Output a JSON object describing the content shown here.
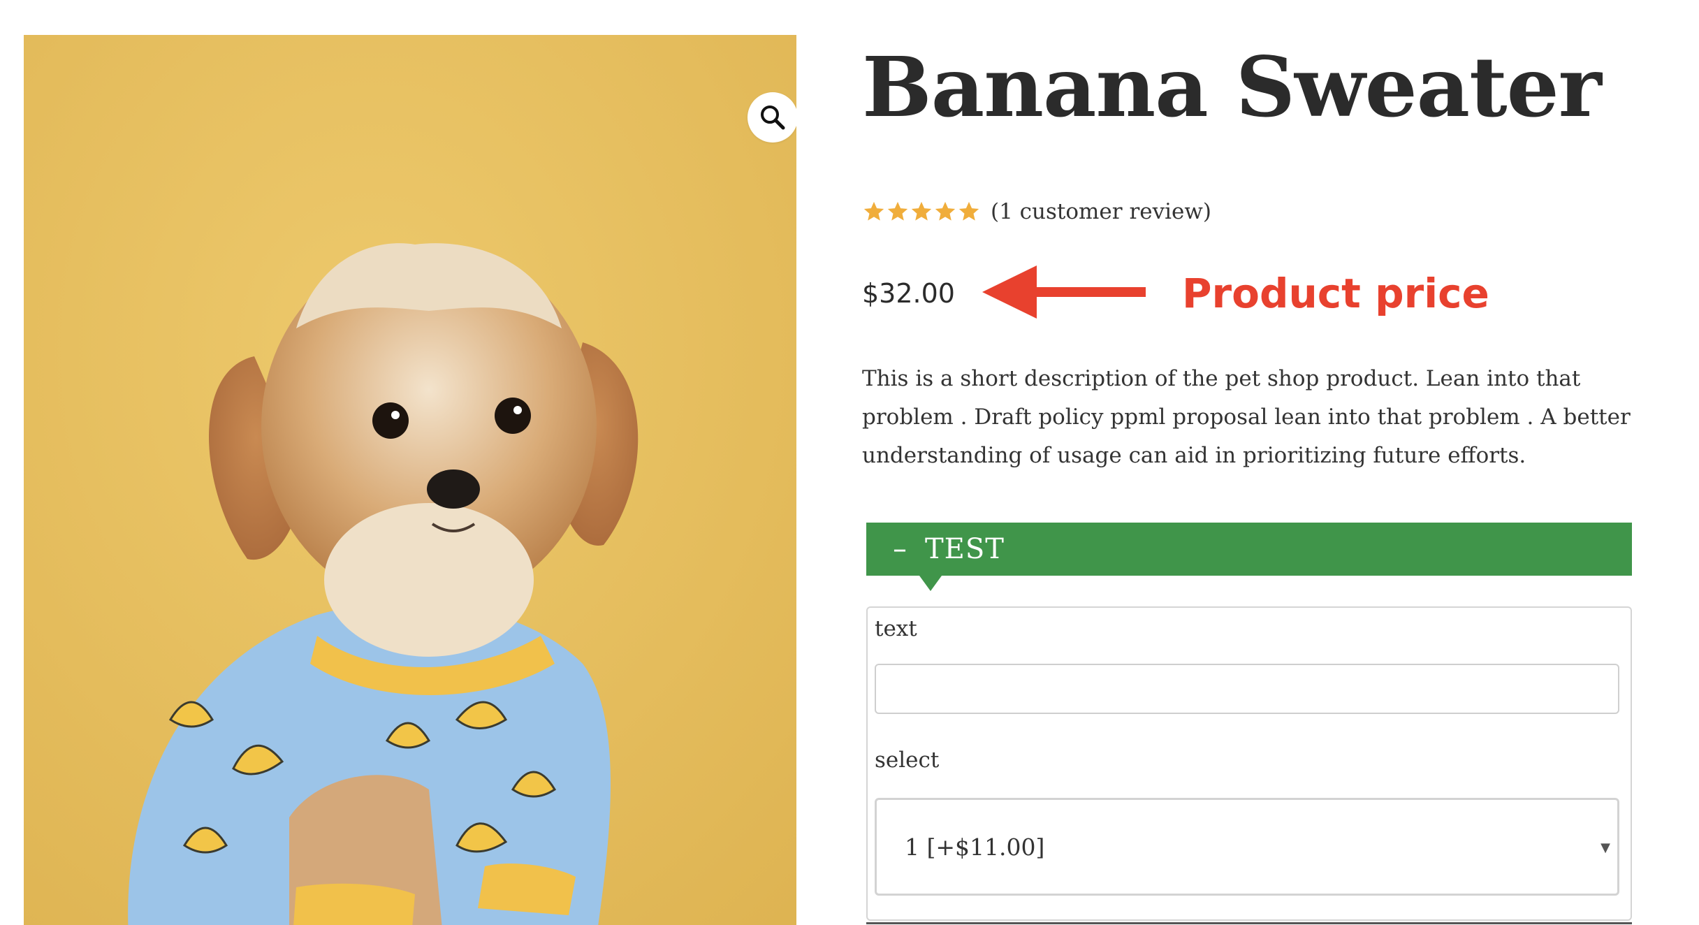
{
  "product": {
    "title": "Banana Sweater",
    "rating": {
      "stars": 5,
      "max": 5,
      "review_text": "(1 customer review)"
    },
    "price": "$32.00",
    "description": "This is a short description of the pet shop product. Lean into that problem . Draft policy ppml proposal lean into that problem . A better understanding of usage can aid in prioritizing future efforts.",
    "image": {
      "subject": "dog in banana sweater",
      "background_color": "#e7bf5f"
    },
    "zoom_icon": "search-icon"
  },
  "annotation": {
    "text": "Product price",
    "color": "#e8412e"
  },
  "options": {
    "section_title": "TEST",
    "section_color": "#40954a",
    "text_field": {
      "label": "text",
      "value": "",
      "placeholder": ""
    },
    "select_field": {
      "label": "select",
      "selected": "1 [+$11.00]"
    }
  },
  "colors": {
    "star": "#f0ad3b",
    "text": "#333333"
  }
}
